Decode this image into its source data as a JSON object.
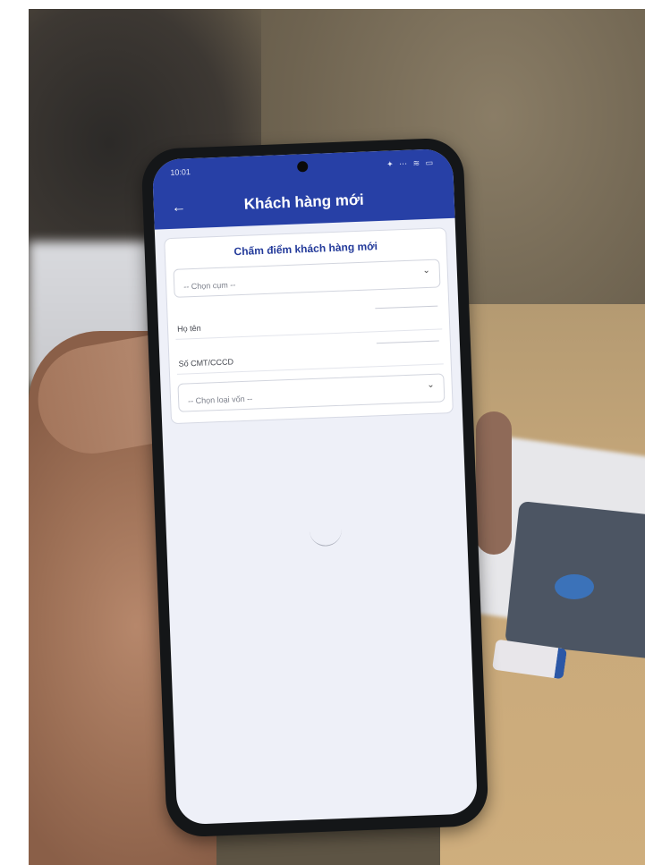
{
  "status_bar": {
    "time": "10:01",
    "icons": "✦ ⋯ ≋ ▭"
  },
  "header": {
    "back_icon": "←",
    "title": "Khách hàng mới"
  },
  "form": {
    "heading": "Chấm điểm khách hàng mới",
    "group_select": {
      "placeholder": "-- Chọn cụm --",
      "chevron": "⌄"
    },
    "full_name": {
      "label": "Họ tên"
    },
    "id_number": {
      "label": "Số CMT/CCCD"
    },
    "loan_type_select": {
      "placeholder": "-- Chọn loại vốn --",
      "chevron": "⌄"
    }
  },
  "colors": {
    "app_bar": "#2740a6",
    "heading": "#233a9a"
  }
}
